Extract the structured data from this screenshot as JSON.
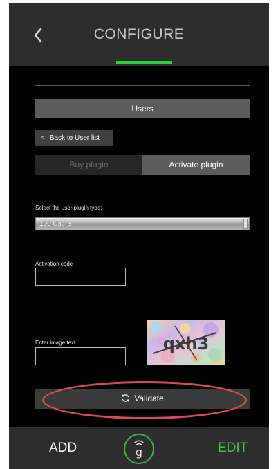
{
  "header": {
    "title": "CONFIGURE",
    "back_icon": "chevron-left-icon",
    "accent_color": "#2ecc40"
  },
  "section": {
    "title": "Users"
  },
  "back_to_list": {
    "label": "Back to User list",
    "icon": "chevron-left-icon"
  },
  "tabs": [
    {
      "label": "Buy plugin",
      "active": false
    },
    {
      "label": "Activate plugin",
      "active": true
    }
  ],
  "plugin_type": {
    "label": "Select the user plugin type:",
    "value": "100 Users"
  },
  "activation_code": {
    "label": "Activation code",
    "value": ""
  },
  "image_text": {
    "label": "Enter image text",
    "value": "",
    "captcha_text": "qxh3"
  },
  "validate": {
    "label": "Validate",
    "icon": "refresh-icon"
  },
  "annotation": {
    "highlight_color": "#d94a52"
  },
  "bottom_bar": {
    "add_label": "ADD",
    "edit_label": "EDIT",
    "logo_icon": "g-logo-icon",
    "edit_color": "#46c24a"
  }
}
